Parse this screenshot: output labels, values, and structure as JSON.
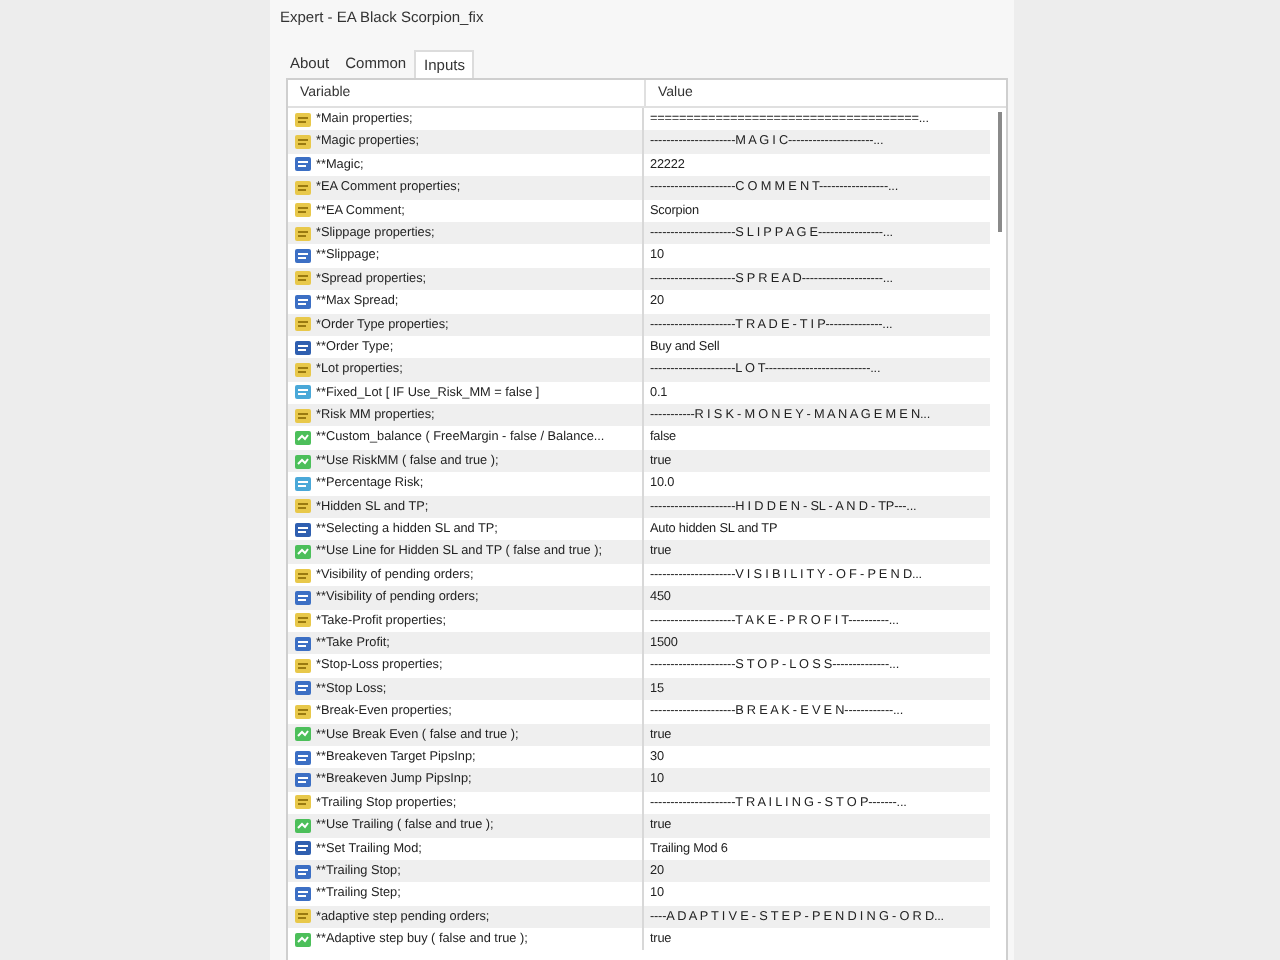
{
  "window": {
    "title": "Expert - EA Black Scorpion_fix"
  },
  "tabs": [
    {
      "label": "About",
      "selected": false
    },
    {
      "label": "Common",
      "selected": false
    },
    {
      "label": "Inputs",
      "selected": true
    }
  ],
  "table": {
    "columns": [
      "Variable",
      "Value"
    ],
    "rows": [
      {
        "kind": "string",
        "variable": "*Main properties;",
        "value": "=====================================..."
      },
      {
        "kind": "string",
        "variable": "*Magic properties;",
        "value": "---------------------M A G I C---------------------..."
      },
      {
        "kind": "int",
        "variable": "**Magic;",
        "value": "22222"
      },
      {
        "kind": "string",
        "variable": "*EA Comment properties;",
        "value": "---------------------C O M M E N T-----------------..."
      },
      {
        "kind": "string",
        "variable": "**EA Comment;",
        "value": "Scorpion"
      },
      {
        "kind": "string",
        "variable": "*Slippage properties;",
        "value": "---------------------S L I P P A G E----------------..."
      },
      {
        "kind": "int",
        "variable": "**Slippage;",
        "value": "10"
      },
      {
        "kind": "string",
        "variable": "*Spread properties;",
        "value": "---------------------S P R E A D--------------------..."
      },
      {
        "kind": "int",
        "variable": "**Max Spread;",
        "value": "20"
      },
      {
        "kind": "string",
        "variable": "*Order Type properties;",
        "value": "---------------------T R A D E - T I P--------------..."
      },
      {
        "kind": "enum",
        "variable": "**Order Type;",
        "value": "Buy and Sell"
      },
      {
        "kind": "string",
        "variable": "*Lot properties;",
        "value": "---------------------L O T--------------------------..."
      },
      {
        "kind": "double",
        "variable": "**Fixed_Lot [ IF  Use_Risk_MM = false ]",
        "value": "0.1"
      },
      {
        "kind": "string",
        "variable": "*Risk MM properties;",
        "value": "-----------R I S K - M O N E Y - M A N A G E M E N..."
      },
      {
        "kind": "bool",
        "variable": "**Custom_balance ( FreeMargin - false / Balance...",
        "value": "false"
      },
      {
        "kind": "bool",
        "variable": "**Use RiskMM ( false and true );",
        "value": "true"
      },
      {
        "kind": "double",
        "variable": "**Percentage Risk;",
        "value": "10.0"
      },
      {
        "kind": "string",
        "variable": "*Hidden SL and TP;",
        "value": "---------------------H I D D E N - SL - A N D - TP---..."
      },
      {
        "kind": "enum",
        "variable": "**Selecting a hidden SL and TP;",
        "value": "Auto hidden SL and TP"
      },
      {
        "kind": "bool",
        "variable": "**Use Line for Hidden SL and TP ( false and true );",
        "value": "true"
      },
      {
        "kind": "string",
        "variable": "*Visibility of pending orders;",
        "value": "---------------------V I S I B I L I T Y - O F - P E N D..."
      },
      {
        "kind": "int",
        "variable": "**Visibility of pending orders;",
        "value": "450"
      },
      {
        "kind": "string",
        "variable": "*Take-Profit properties;",
        "value": "---------------------T A K E - P R O F I T----------..."
      },
      {
        "kind": "int",
        "variable": "**Take Profit;",
        "value": "1500"
      },
      {
        "kind": "string",
        "variable": "*Stop-Loss properties;",
        "value": "---------------------S T O P - L O S S--------------..."
      },
      {
        "kind": "int",
        "variable": "**Stop Loss;",
        "value": "15"
      },
      {
        "kind": "string",
        "variable": "*Break-Even properties;",
        "value": "---------------------B R E A K - E V E N------------..."
      },
      {
        "kind": "bool",
        "variable": "**Use Break Even ( false and true );",
        "value": "true"
      },
      {
        "kind": "int",
        "variable": "**Breakeven Target PipsInp;",
        "value": "30"
      },
      {
        "kind": "int",
        "variable": "**Breakeven Jump PipsInp;",
        "value": "10"
      },
      {
        "kind": "string",
        "variable": "*Trailing Stop properties;",
        "value": "---------------------T R A I L I N G - S T O P-------..."
      },
      {
        "kind": "bool",
        "variable": "**Use Trailing ( false and true );",
        "value": "true"
      },
      {
        "kind": "enum",
        "variable": "**Set Trailing Mod;",
        "value": "Trailing Mod 6"
      },
      {
        "kind": "int",
        "variable": "**Trailing Stop;",
        "value": "20"
      },
      {
        "kind": "int",
        "variable": "**Trailing Step;",
        "value": "10"
      },
      {
        "kind": "string",
        "variable": "*adaptive step pending orders;",
        "value": "----A D A P T I V E - S T E P - P E N D I N G - O R D..."
      },
      {
        "kind": "bool",
        "variable": "**Adaptive step buy ( false and true );",
        "value": "true"
      }
    ]
  }
}
